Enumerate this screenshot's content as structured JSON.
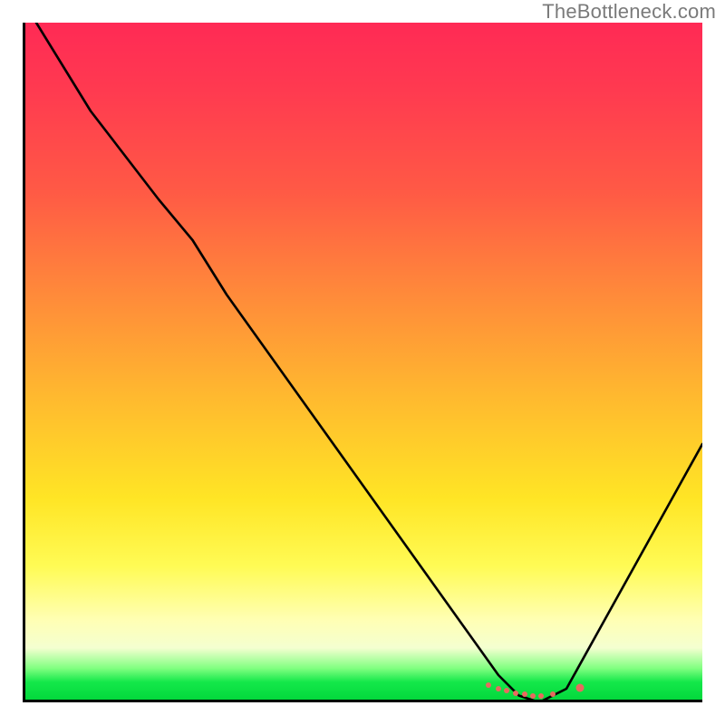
{
  "watermark": "TheBottleneck.com",
  "colors": {
    "axis": "#000000",
    "curve": "#000000",
    "marker": "#e86a5f"
  },
  "chart_data": {
    "type": "line",
    "title": "",
    "xlabel": "",
    "ylabel": "",
    "xlim": [
      0,
      100
    ],
    "ylim": [
      0,
      100
    ],
    "grid": false,
    "legend": false,
    "annotations": [
      "TheBottleneck.com"
    ],
    "series": [
      {
        "name": "curve",
        "x": [
          2,
          10,
          20,
          25,
          30,
          40,
          50,
          60,
          65,
          70,
          73,
          76,
          80,
          85,
          90,
          100
        ],
        "y": [
          100,
          87,
          74,
          68,
          60,
          46,
          32,
          18,
          11,
          4,
          1,
          0,
          2,
          11,
          20,
          38
        ]
      }
    ],
    "markers": {
      "name": "points",
      "values": [
        {
          "x": 68.5,
          "y": 2.5,
          "size": 6
        },
        {
          "x": 70.0,
          "y": 2.0,
          "size": 6
        },
        {
          "x": 71.2,
          "y": 1.7,
          "size": 6
        },
        {
          "x": 72.5,
          "y": 1.4,
          "size": 6
        },
        {
          "x": 73.8,
          "y": 1.2,
          "size": 6
        },
        {
          "x": 75.0,
          "y": 1.0,
          "size": 6
        },
        {
          "x": 76.3,
          "y": 1.0,
          "size": 6
        },
        {
          "x": 78.0,
          "y": 1.2,
          "size": 6
        },
        {
          "x": 82.0,
          "y": 2.2,
          "size": 9
        }
      ]
    }
  }
}
